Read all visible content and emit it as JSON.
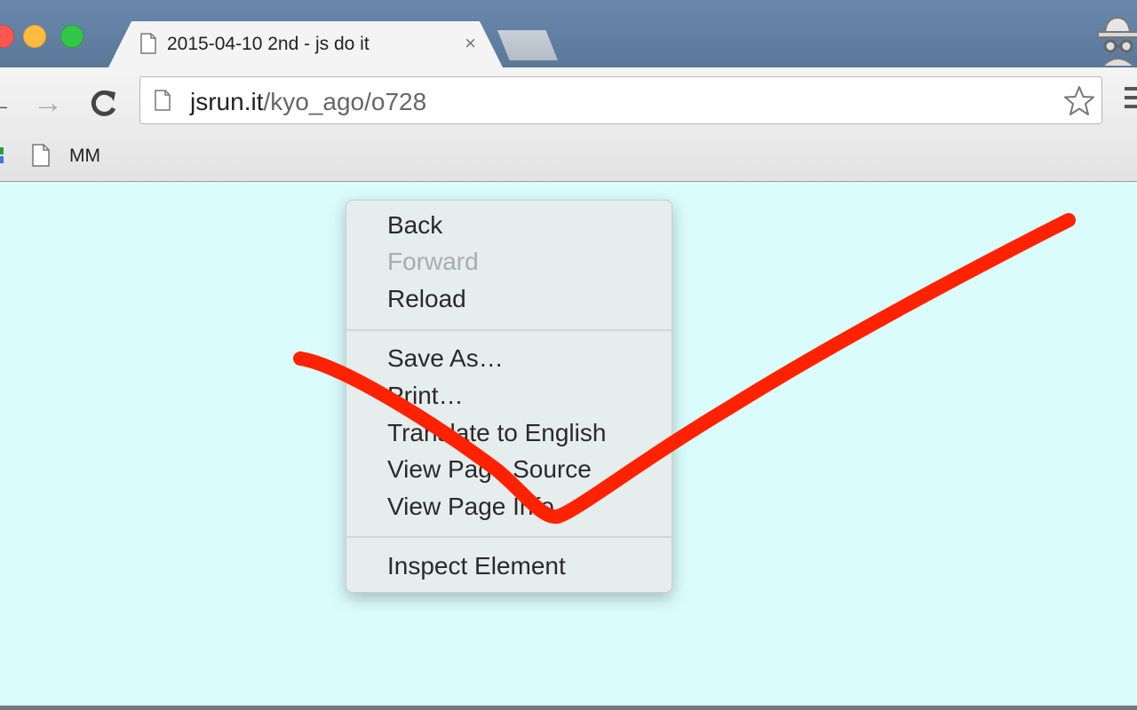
{
  "window": {
    "tab": {
      "title": "2015-04-10 2nd - js do it",
      "close_glyph": "×"
    },
    "nav": {
      "back_glyph": "←",
      "forward_glyph": "→",
      "reload_glyph": "C"
    },
    "address": {
      "host": "jsrun.it",
      "path": "/kyo_ago/o728"
    },
    "bookmarks": [
      {
        "label": "MM"
      }
    ]
  },
  "context_menu": {
    "items": [
      {
        "label": "Back",
        "enabled": true
      },
      {
        "label": "Forward",
        "enabled": false
      },
      {
        "label": "Reload",
        "enabled": true
      },
      {
        "label": "Save As…",
        "enabled": true
      },
      {
        "label": "Print…",
        "enabled": true
      },
      {
        "label": "Translate to English",
        "enabled": true
      },
      {
        "label": "View Page Source",
        "enabled": true
      },
      {
        "label": "View Page Info",
        "enabled": true
      },
      {
        "label": "Inspect Element",
        "enabled": true
      }
    ]
  },
  "colors": {
    "page_background": "#dafcfd",
    "annotation_stroke": "#ff2200",
    "menu_background": "#e6eded"
  },
  "icons": [
    "page-icon",
    "star-icon",
    "incognito-icon",
    "menu-icon",
    "back-icon",
    "forward-icon",
    "reload-icon",
    "close-icon"
  ]
}
